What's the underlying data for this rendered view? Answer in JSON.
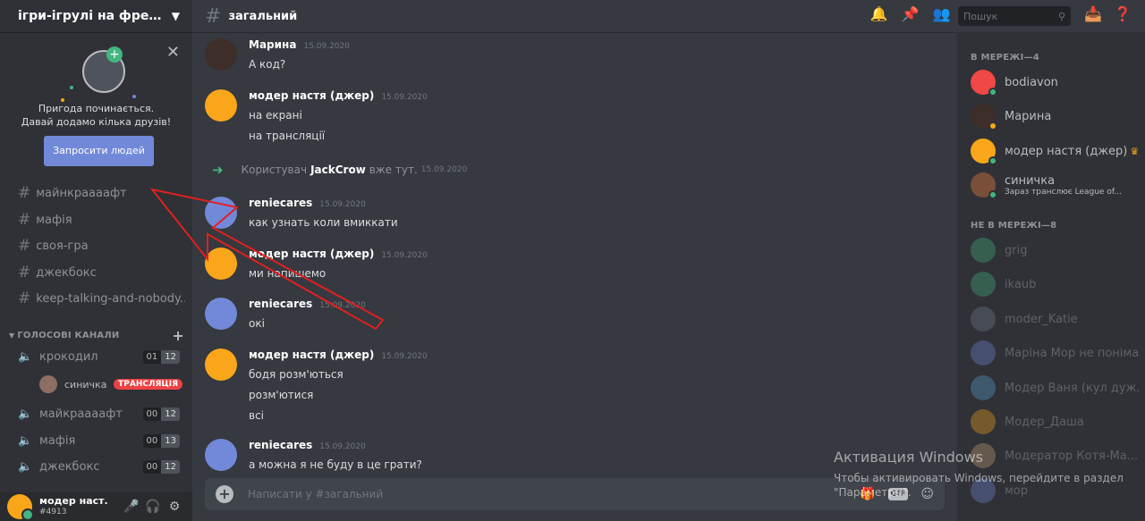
{
  "guild": {
    "name": "ігри-ігрулі на фрешфест..."
  },
  "promo": {
    "line1": "Пригода починається.",
    "line2": "Давай додамо кілька друзів!",
    "invite_label": "Запросити людей"
  },
  "text_channels": [
    "майнкраааафт",
    "мафія",
    "своя-гра",
    "джекбокс",
    "keep-talking-and-nobody..."
  ],
  "voice_category": {
    "label": "ГОЛОСОВІ КАНАЛИ"
  },
  "voice_channels": [
    {
      "name": "крокодил",
      "count": "01",
      "limit": "12"
    },
    {
      "name": "майкраааафт",
      "count": "00",
      "limit": "12"
    },
    {
      "name": "мафія",
      "count": "00",
      "limit": "13"
    },
    {
      "name": "джекбокс",
      "count": "00",
      "limit": "12"
    }
  ],
  "voice_user": {
    "name": "синичка",
    "badge": "ТРАНСЛЯЦІЯ"
  },
  "userbar": {
    "name": "модер наст...",
    "tag": "#4913"
  },
  "channel": {
    "title": "загальний"
  },
  "search": {
    "placeholder": "Пошук"
  },
  "messages": [
    {
      "user": "Марина",
      "time": "15.09.2020",
      "lines": [
        "А код?"
      ]
    },
    {
      "user": "модер настя (джер)",
      "time": "15.09.2020",
      "lines": [
        "на екрані",
        "на трансляції"
      ]
    },
    {
      "user": "reniecares",
      "time": "15.09.2020",
      "lines": [
        "как узнать коли вмиккати"
      ]
    },
    {
      "user": "модер настя (джер)",
      "time": "15.09.2020",
      "lines": [
        "ми напишемо"
      ]
    },
    {
      "user": "reniecares",
      "time": "15.09.2020",
      "lines": [
        "окі"
      ]
    },
    {
      "user": "модер настя (джер)",
      "time": "15.09.2020",
      "lines": [
        "бодя розм'ються",
        "розм'ютися",
        "всі"
      ]
    },
    {
      "user": "reniecares",
      "time": "15.09.2020",
      "lines": [
        "а можна я не буду в це грати?"
      ]
    }
  ],
  "join": {
    "prefix": "Користувач",
    "name": "JackCrow",
    "suffix": "вже тут.",
    "time": "15.09.2020"
  },
  "composer": {
    "placeholder": "Написати у #загальний",
    "gif_label": "GIF"
  },
  "members": {
    "online_label": "В МЕРЕЖІ—4",
    "offline_label": "НЕ В МЕРЕЖІ—8",
    "online": [
      {
        "name": "bodiavon"
      },
      {
        "name": "Марина"
      },
      {
        "name": "модер настя (джер)"
      },
      {
        "name": "синичка",
        "activity": "Зараз транслює League of..."
      }
    ],
    "offline": [
      {
        "name": "grig"
      },
      {
        "name": "ikaub"
      },
      {
        "name": "moder_Katie"
      },
      {
        "name": "Маріна Мор не поніма..."
      },
      {
        "name": "Модер Ваня (кул дуж..."
      },
      {
        "name": "Модер_Даша"
      },
      {
        "name": "Модератор Котя-Ма..."
      },
      {
        "name": "мор"
      }
    ]
  },
  "watermark": {
    "title": "Активация Windows",
    "line1": "Чтобы активировать Windows, перейдите в раздел",
    "line2": "\"Параметры\"."
  },
  "colors": {
    "accent": "#7289da",
    "online": "#43b581",
    "idle": "#faa61a",
    "live": "#ed4245",
    "annotation": "#e02020"
  }
}
